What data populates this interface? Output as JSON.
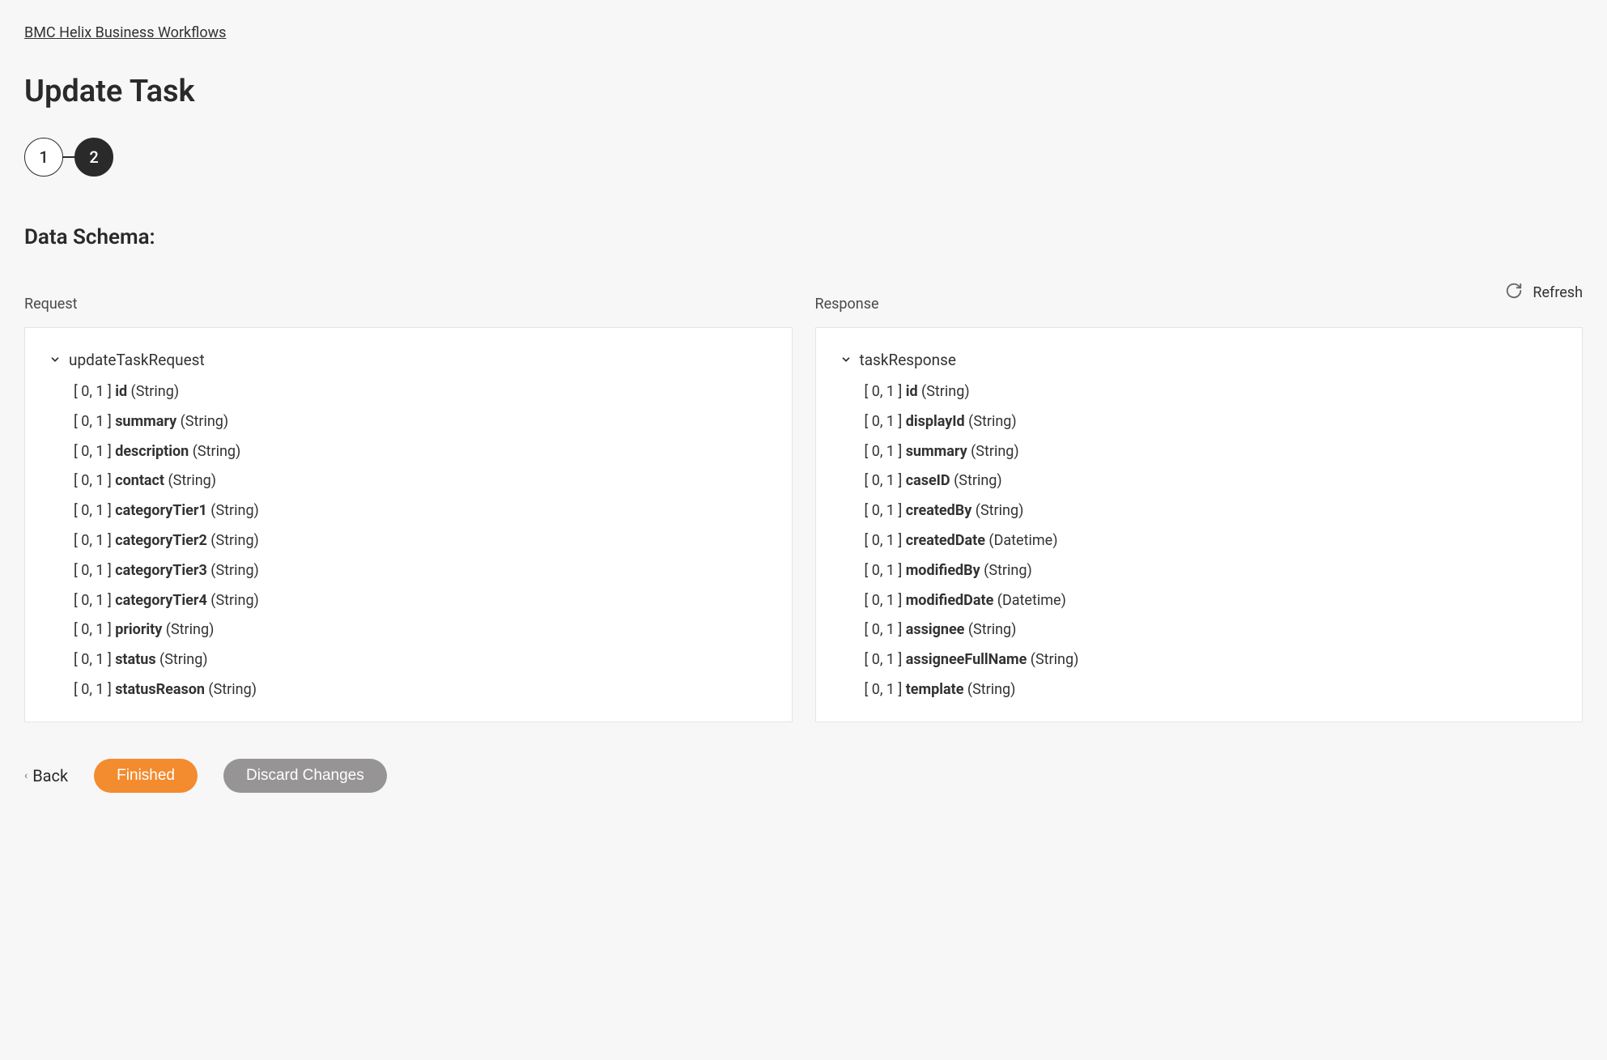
{
  "breadcrumb": "BMC Helix Business Workflows",
  "page_title": "Update Task",
  "stepper": {
    "step1": "1",
    "step2": "2"
  },
  "section_title": "Data Schema:",
  "refresh_label": "Refresh",
  "request": {
    "label": "Request",
    "root": "updateTaskRequest",
    "fields": [
      {
        "range": "[ 0, 1 ]",
        "name": "id",
        "type": "(String)"
      },
      {
        "range": "[ 0, 1 ]",
        "name": "summary",
        "type": "(String)"
      },
      {
        "range": "[ 0, 1 ]",
        "name": "description",
        "type": "(String)"
      },
      {
        "range": "[ 0, 1 ]",
        "name": "contact",
        "type": "(String)"
      },
      {
        "range": "[ 0, 1 ]",
        "name": "categoryTier1",
        "type": "(String)"
      },
      {
        "range": "[ 0, 1 ]",
        "name": "categoryTier2",
        "type": "(String)"
      },
      {
        "range": "[ 0, 1 ]",
        "name": "categoryTier3",
        "type": "(String)"
      },
      {
        "range": "[ 0, 1 ]",
        "name": "categoryTier4",
        "type": "(String)"
      },
      {
        "range": "[ 0, 1 ]",
        "name": "priority",
        "type": "(String)"
      },
      {
        "range": "[ 0, 1 ]",
        "name": "status",
        "type": "(String)"
      },
      {
        "range": "[ 0, 1 ]",
        "name": "statusReason",
        "type": "(String)"
      }
    ]
  },
  "response": {
    "label": "Response",
    "root": "taskResponse",
    "fields": [
      {
        "range": "[ 0, 1 ]",
        "name": "id",
        "type": "(String)"
      },
      {
        "range": "[ 0, 1 ]",
        "name": "displayId",
        "type": "(String)"
      },
      {
        "range": "[ 0, 1 ]",
        "name": "summary",
        "type": "(String)"
      },
      {
        "range": "[ 0, 1 ]",
        "name": "caseID",
        "type": "(String)"
      },
      {
        "range": "[ 0, 1 ]",
        "name": "createdBy",
        "type": "(String)"
      },
      {
        "range": "[ 0, 1 ]",
        "name": "createdDate",
        "type": "(Datetime)"
      },
      {
        "range": "[ 0, 1 ]",
        "name": "modifiedBy",
        "type": "(String)"
      },
      {
        "range": "[ 0, 1 ]",
        "name": "modifiedDate",
        "type": "(Datetime)"
      },
      {
        "range": "[ 0, 1 ]",
        "name": "assignee",
        "type": "(String)"
      },
      {
        "range": "[ 0, 1 ]",
        "name": "assigneeFullName",
        "type": "(String)"
      },
      {
        "range": "[ 0, 1 ]",
        "name": "template",
        "type": "(String)"
      }
    ]
  },
  "footer": {
    "back": "Back",
    "finished": "Finished",
    "discard": "Discard Changes"
  }
}
